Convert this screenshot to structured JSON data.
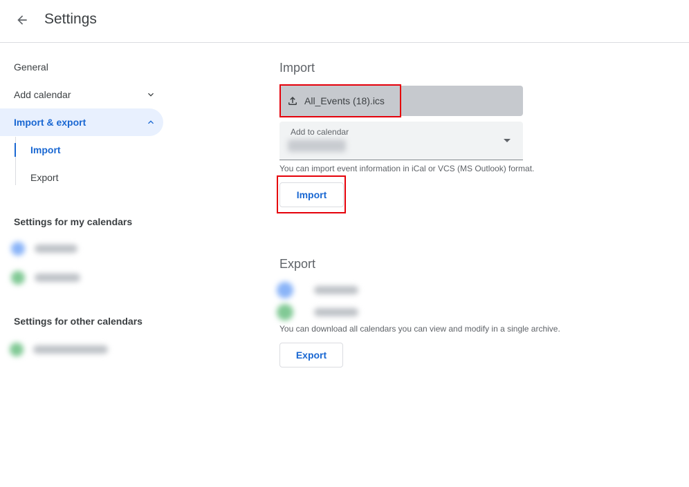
{
  "header": {
    "title": "Settings",
    "back_icon": "arrow-left-icon"
  },
  "sidebar": {
    "items": [
      {
        "label": "General"
      },
      {
        "label": "Add calendar",
        "icon": "chevron-down-icon"
      },
      {
        "label": "Import & export",
        "icon": "chevron-up-icon",
        "expanded": true
      },
      {
        "label": "Import",
        "selected": true
      },
      {
        "label": "Export"
      }
    ],
    "my_calendars_heading": "Settings for my calendars",
    "other_calendars_heading": "Settings for other calendars"
  },
  "import": {
    "heading": "Import",
    "file_name": "All_Events (18).ics",
    "upload_icon": "upload-icon",
    "add_to_calendar_label": "Add to calendar",
    "help_text": "You can import event information in iCal or VCS (MS Outlook) format.",
    "button_label": "Import"
  },
  "export": {
    "heading": "Export",
    "help_text": "You can download all calendars you can view and modify in a single archive.",
    "button_label": "Export"
  },
  "colors": {
    "accent": "#1967d2",
    "active_bg": "#e8f0fe",
    "highlight": "#e5000a",
    "file_picker_bg": "#c6c9ce",
    "calendar_blue": "#8ab4f8",
    "calendar_green": "#81c995"
  }
}
